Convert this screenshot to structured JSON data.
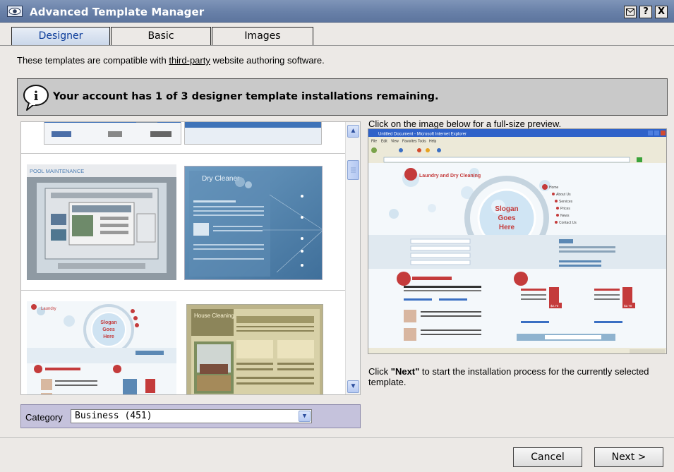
{
  "window": {
    "title": "Advanced Template Manager",
    "controls": {
      "help": "?",
      "close": "X"
    }
  },
  "tabs": [
    {
      "label": "Designer",
      "active": true
    },
    {
      "label": "Basic",
      "active": false
    },
    {
      "label": "Images",
      "active": false
    }
  ],
  "intro": {
    "before": "These templates are compatible with ",
    "link": "third-party",
    "after": " website authoring software."
  },
  "notice": {
    "message": "Your account has 1 of 3 designer template installations remaining."
  },
  "gallery": {
    "thumbnails": [
      {
        "title": "POOL MAINTENANCE"
      },
      {
        "title": "Dry Cleaner"
      },
      {
        "title": "Laundry and Dry Cleaning",
        "slogan": [
          "Slogan",
          "Goes",
          "Here"
        ]
      },
      {
        "title": "House Cleaning"
      }
    ]
  },
  "category": {
    "label": "Category",
    "selected": "Business (451)"
  },
  "preview": {
    "hint": "Click on the image below for a full-size preview.",
    "browser_title": "Untitled Document - Microsoft Internet Explorer",
    "menus": [
      "File",
      "Edit",
      "View",
      "Favorites",
      "Tools",
      "Help"
    ],
    "site_title": "Laundry and Dry Cleaning",
    "slogan": [
      "Slogan",
      "Goes",
      "Here"
    ],
    "nav": [
      "Home",
      "About Us",
      "Services",
      "Prices",
      "News",
      "Contact Us"
    ],
    "prices": [
      "$2.70",
      "$2.70"
    ]
  },
  "next_hint": {
    "prefix": "Click ",
    "keyword": "\"Next\"",
    "suffix": " to start the installation process for the currently selected template."
  },
  "buttons": {
    "cancel": "Cancel",
    "next": "Next >"
  },
  "colors": {
    "titlebar": "#6880a8",
    "active_tab_text": "#0b3c9a",
    "notice_bg": "#c9c9c9",
    "category_bg": "#c5c2dc"
  }
}
